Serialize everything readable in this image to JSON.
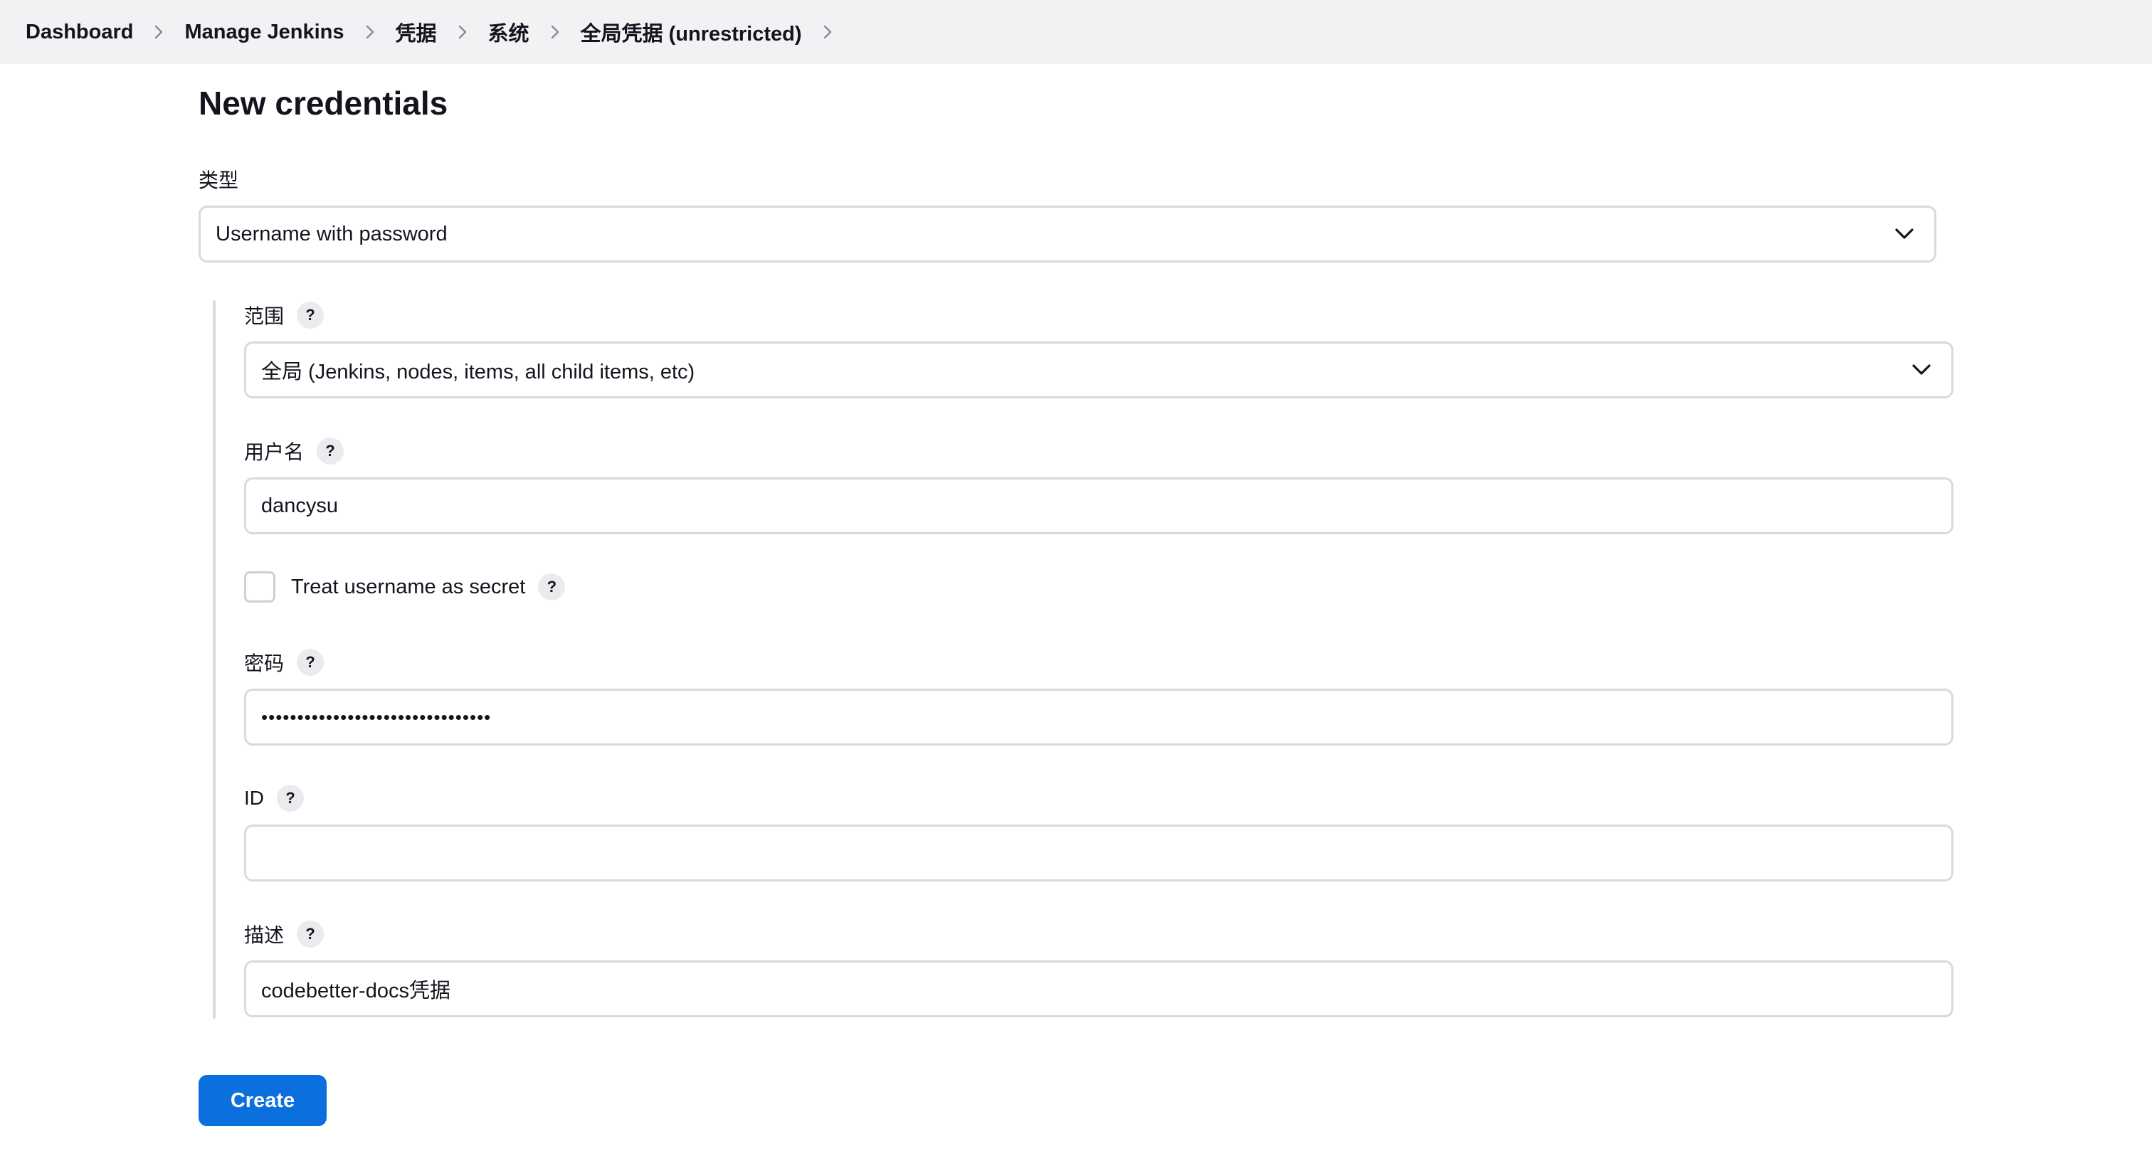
{
  "breadcrumb": [
    {
      "label": "Dashboard"
    },
    {
      "label": "Manage Jenkins"
    },
    {
      "label": "凭据"
    },
    {
      "label": "系统"
    },
    {
      "label": "全局凭据 (unrestricted)"
    }
  ],
  "page_title": "New credentials",
  "form": {
    "kind": {
      "label": "类型",
      "value": "Username with password"
    },
    "scope": {
      "label": "范围",
      "value": "全局 (Jenkins, nodes, items, all child items, etc)"
    },
    "username": {
      "label": "用户名",
      "value": "dancysu"
    },
    "treat_secret": {
      "label": "Treat username as secret",
      "checked": false
    },
    "password": {
      "label": "密码",
      "value": "••••••••••••••••••••••••••••••••"
    },
    "id": {
      "label": "ID",
      "value": ""
    },
    "description": {
      "label": "描述",
      "value": "codebetter-docs凭据"
    },
    "help_label": "?",
    "create_label": "Create"
  },
  "colors": {
    "accent": "#0b6fde",
    "breadcrumb_bg": "#f2f2f4",
    "border": "#d9d9df"
  },
  "icons": {
    "breadcrumb_separator": "chevron-right-icon",
    "select_arrow": "chevron-down-icon"
  }
}
